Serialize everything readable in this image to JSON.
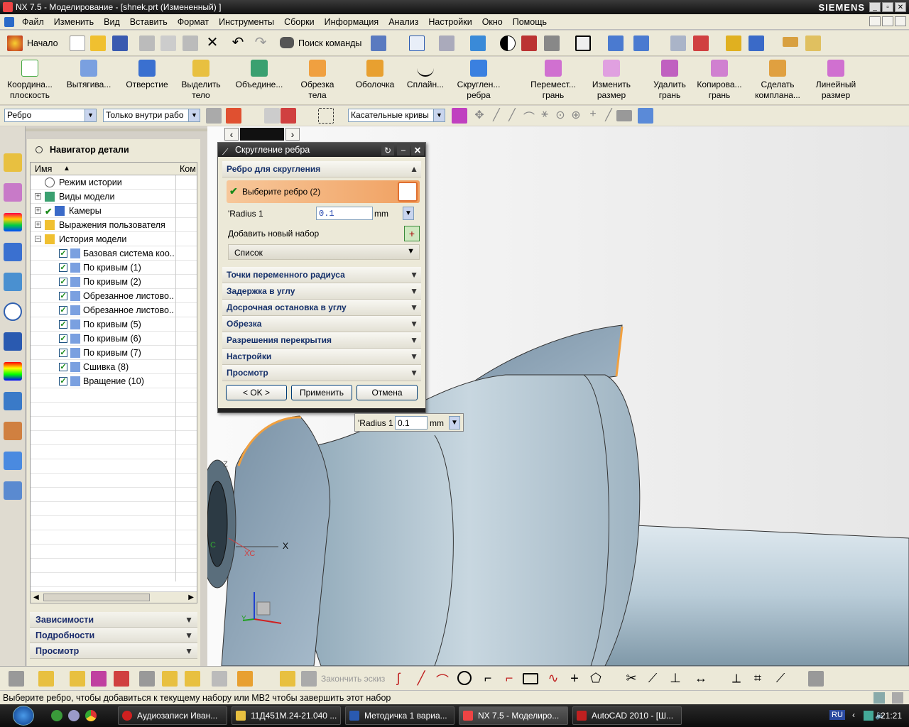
{
  "window": {
    "title": "NX 7.5 - Моделирование - [shnek.prt (Измененный) ]",
    "brand": "SIEMENS"
  },
  "menu": [
    "Файл",
    "Изменить",
    "Вид",
    "Вставить",
    "Формат",
    "Инструменты",
    "Сборки",
    "Информация",
    "Анализ",
    "Настройки",
    "Окно",
    "Помощь"
  ],
  "toolbar1": {
    "start": "Начало",
    "search": "Поиск команды"
  },
  "toolbar2": [
    {
      "l1": "Координа...",
      "l2": "плоскость"
    },
    {
      "l1": "Вытягива...",
      "l2": ""
    },
    {
      "l1": "Отверстие",
      "l2": ""
    },
    {
      "l1": "Выделить",
      "l2": "тело"
    },
    {
      "l1": "Объедине...",
      "l2": ""
    },
    {
      "l1": "Обрезка",
      "l2": "тела"
    },
    {
      "l1": "Оболочка",
      "l2": ""
    },
    {
      "l1": "Сплайн...",
      "l2": ""
    },
    {
      "l1": "Скруглен...",
      "l2": "ребра"
    },
    {
      "l1": "Перемест...",
      "l2": "грань"
    },
    {
      "l1": "Изменить",
      "l2": "размер"
    },
    {
      "l1": "Удалить",
      "l2": "грань"
    },
    {
      "l1": "Копирова...",
      "l2": "грань"
    },
    {
      "l1": "Сделать",
      "l2": "компланa..."
    },
    {
      "l1": "Линейный",
      "l2": "размер"
    }
  ],
  "selbar": {
    "filter": "Ребро",
    "scope": "Только внутри рабо",
    "rule": "Касательные кривы"
  },
  "navigator": {
    "title": "Навигатор детали",
    "col_name": "Имя",
    "col_comment": "Ком",
    "items": [
      {
        "label": "Режим истории",
        "level": 0,
        "check": false
      },
      {
        "label": "Виды модели",
        "level": 0,
        "check": false
      },
      {
        "label": "Камеры",
        "level": 0,
        "check": true
      },
      {
        "label": "Выражения пользователя",
        "level": 0,
        "check": false
      },
      {
        "label": "История модели",
        "level": 0,
        "check": false
      },
      {
        "label": "Базовая система коо...",
        "level": 1,
        "check": true
      },
      {
        "label": "По кривым (1)",
        "level": 1,
        "check": true
      },
      {
        "label": "По кривым (2)",
        "level": 1,
        "check": true
      },
      {
        "label": "Обрезанное листово...",
        "level": 1,
        "check": true
      },
      {
        "label": "Обрезанное листово...",
        "level": 1,
        "check": true
      },
      {
        "label": "По кривым (5)",
        "level": 1,
        "check": true
      },
      {
        "label": "По кривым (6)",
        "level": 1,
        "check": true
      },
      {
        "label": "По кривым (7)",
        "level": 1,
        "check": true
      },
      {
        "label": "Сшивка (8)",
        "level": 1,
        "check": true
      },
      {
        "label": "Вращение (10)",
        "level": 1,
        "check": true
      }
    ],
    "sections": [
      "Зависимости",
      "Подробности",
      "Просмотр"
    ]
  },
  "dialog": {
    "title": "Скругление ребра",
    "group1": "Ребро для скругления",
    "select": "Выберите ребро (2)",
    "radius_label": "'Radius 1",
    "radius_value": "0.1",
    "unit": "mm",
    "add_set": "Добавить новый набор",
    "list": "Список",
    "sections": [
      "Точки переменного радиуса",
      "Задержка в углу",
      "Досрочная остановка в углу",
      "Обрезка",
      "Разрешения перекрытия",
      "Настройки",
      "Просмотр"
    ],
    "ok": "< OK >",
    "apply": "Применить",
    "cancel": "Отмена"
  },
  "onscreen": {
    "label": "'Radius 1",
    "value": "0.1",
    "unit": "mm"
  },
  "axes": {
    "x": "X",
    "z": "Z",
    "xc": "XC",
    "c": "C",
    "y": "Y"
  },
  "cmdbar": {
    "finish_sketch": "Закончить эскиз"
  },
  "status": "Выберите ребро, чтобы добавиться к текущему набору или MB2 чтобы завершить этот набор",
  "taskbar": {
    "tasks": [
      "Аудиозаписи Иван...",
      "11Д451М.24-21.040 ...",
      "Методичка 1 вариа...",
      "NX 7.5 - Моделиро...",
      "AutoCAD 2010 - [Ш..."
    ],
    "lang": "RU",
    "time": "21:21"
  },
  "colors": {
    "accent_orange": "#f0a040",
    "check_green": "#1a8a1a",
    "title_dark": "#222222",
    "model_blue": "#b4c8d6"
  }
}
